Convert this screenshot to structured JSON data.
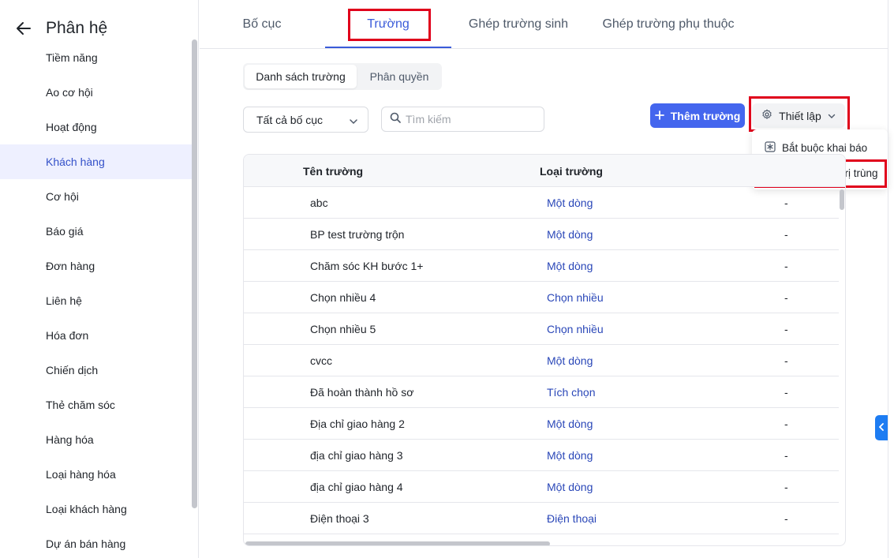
{
  "sidebar": {
    "title": "Phân hệ",
    "items": [
      {
        "label": "Tiềm năng"
      },
      {
        "label": "Ao cơ hội"
      },
      {
        "label": "Hoạt động"
      },
      {
        "label": "Khách hàng"
      },
      {
        "label": "Cơ hội"
      },
      {
        "label": "Báo giá"
      },
      {
        "label": "Đơn hàng"
      },
      {
        "label": "Liên hệ"
      },
      {
        "label": "Hóa đơn"
      },
      {
        "label": "Chiến dịch"
      },
      {
        "label": "Thẻ chăm sóc"
      },
      {
        "label": "Hàng hóa"
      },
      {
        "label": "Loại hàng hóa"
      },
      {
        "label": "Loại khách hàng"
      },
      {
        "label": "Dự án bán hàng"
      }
    ],
    "active_item": "Khách hàng"
  },
  "tabs": [
    {
      "label": "Bố cục"
    },
    {
      "label": "Trường"
    },
    {
      "label": "Ghép trường sinh"
    },
    {
      "label": "Ghép trường phụ thuộc"
    }
  ],
  "subtabs": [
    {
      "label": "Danh sách trường"
    },
    {
      "label": "Phân quyền"
    }
  ],
  "filters": {
    "layout_select": "Tất cả bố cục",
    "search_placeholder": "Tìm kiếm"
  },
  "toolbar": {
    "add_label": "Thêm trường",
    "setup_label": "Thiết lập"
  },
  "setup_menu": [
    {
      "label": "Bắt buộc khai báo",
      "icon": "asterisk-box-icon"
    },
    {
      "label": "Kiểm tra giá trị trùng",
      "icon": "copy-icon"
    }
  ],
  "table": {
    "columns": [
      "Tên trường",
      "Loại trường"
    ],
    "rows": [
      {
        "name": "abc",
        "type": "Một dòng",
        "extra": "-"
      },
      {
        "name": "BP test trường trộn",
        "type": "Một dòng",
        "extra": "-"
      },
      {
        "name": "Chăm sóc KH bước 1+",
        "type": "Một dòng",
        "extra": "-"
      },
      {
        "name": "Chọn nhiều 4",
        "type": "Chọn nhiều",
        "extra": "-"
      },
      {
        "name": "Chọn nhiều 5",
        "type": "Chọn nhiều",
        "extra": "-"
      },
      {
        "name": "cvcc",
        "type": "Một dòng",
        "extra": "-"
      },
      {
        "name": "Đã hoàn thành hồ sơ",
        "type": "Tích chọn",
        "extra": "-"
      },
      {
        "name": "Địa chỉ giao hàng 2",
        "type": "Một dòng",
        "extra": "-"
      },
      {
        "name": "địa chỉ giao hàng 3",
        "type": "Một dòng",
        "extra": "-"
      },
      {
        "name": "địa chỉ giao hàng 4",
        "type": "Một dòng",
        "extra": "-"
      },
      {
        "name": "Điện thoại 3",
        "type": "Điện thoại",
        "extra": "-"
      }
    ]
  },
  "colors": {
    "accent": "#4466ee",
    "link": "#2a47b8",
    "highlight": "#e0001b",
    "active_bg": "#eef0ff",
    "toggle": "#1d7cf2"
  }
}
